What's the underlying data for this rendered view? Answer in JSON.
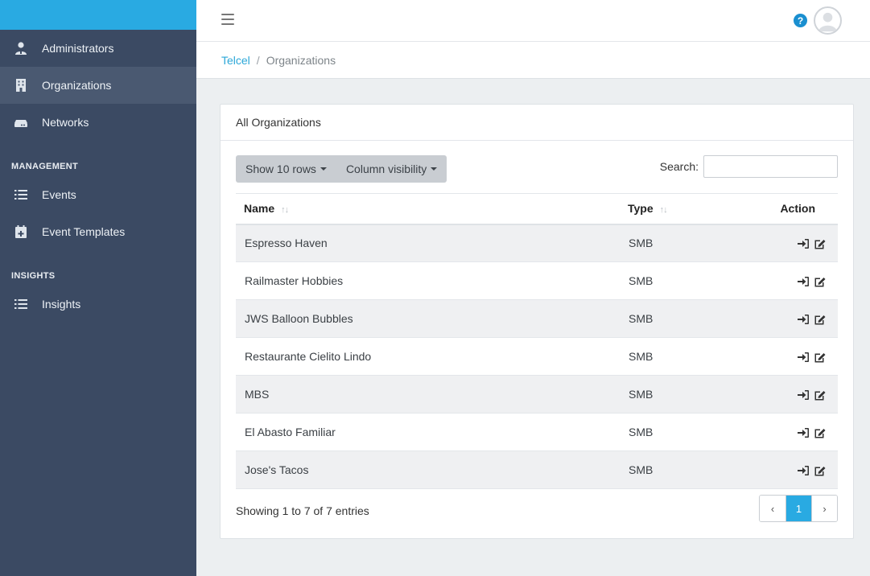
{
  "sidebar": {
    "items": [
      {
        "label": "Administrators",
        "icon": "user-icon"
      },
      {
        "label": "Organizations",
        "icon": "building-icon",
        "active": true
      },
      {
        "label": "Networks",
        "icon": "router-icon"
      }
    ],
    "management_header": "MANAGEMENT",
    "management_items": [
      {
        "label": "Events",
        "icon": "list-icon"
      },
      {
        "label": "Event Templates",
        "icon": "calendar-plus-icon"
      }
    ],
    "insights_header": "INSIGHTS",
    "insights_items": [
      {
        "label": "Insights",
        "icon": "list-icon"
      }
    ]
  },
  "topbar": {
    "help_symbol": "?"
  },
  "breadcrumb": {
    "root": "Telcel",
    "separator": "/",
    "current": "Organizations"
  },
  "card": {
    "title": "All Organizations",
    "show_rows": "Show 10 rows",
    "column_visibility": "Column visibility",
    "search_label": "Search:",
    "search_value": "",
    "columns": {
      "name": "Name",
      "type": "Type",
      "action": "Action"
    },
    "sort_glyph": "↑↓",
    "rows": [
      {
        "name": "Espresso Haven",
        "type": "SMB"
      },
      {
        "name": "Railmaster Hobbies",
        "type": "SMB"
      },
      {
        "name": "JWS Balloon Bubbles",
        "type": "SMB"
      },
      {
        "name": "Restaurante Cielito Lindo",
        "type": "SMB"
      },
      {
        "name": "MBS",
        "type": "SMB"
      },
      {
        "name": "El Abasto Familiar",
        "type": "SMB"
      },
      {
        "name": "Jose's Tacos",
        "type": "SMB"
      }
    ],
    "showing": "Showing 1 to 7 of 7 entries",
    "pager": {
      "prev": "‹",
      "page": "1",
      "next": "›"
    }
  },
  "colors": {
    "accent": "#29aae2",
    "sidebar": "#3b4a63",
    "help": "#1a8fd0"
  }
}
